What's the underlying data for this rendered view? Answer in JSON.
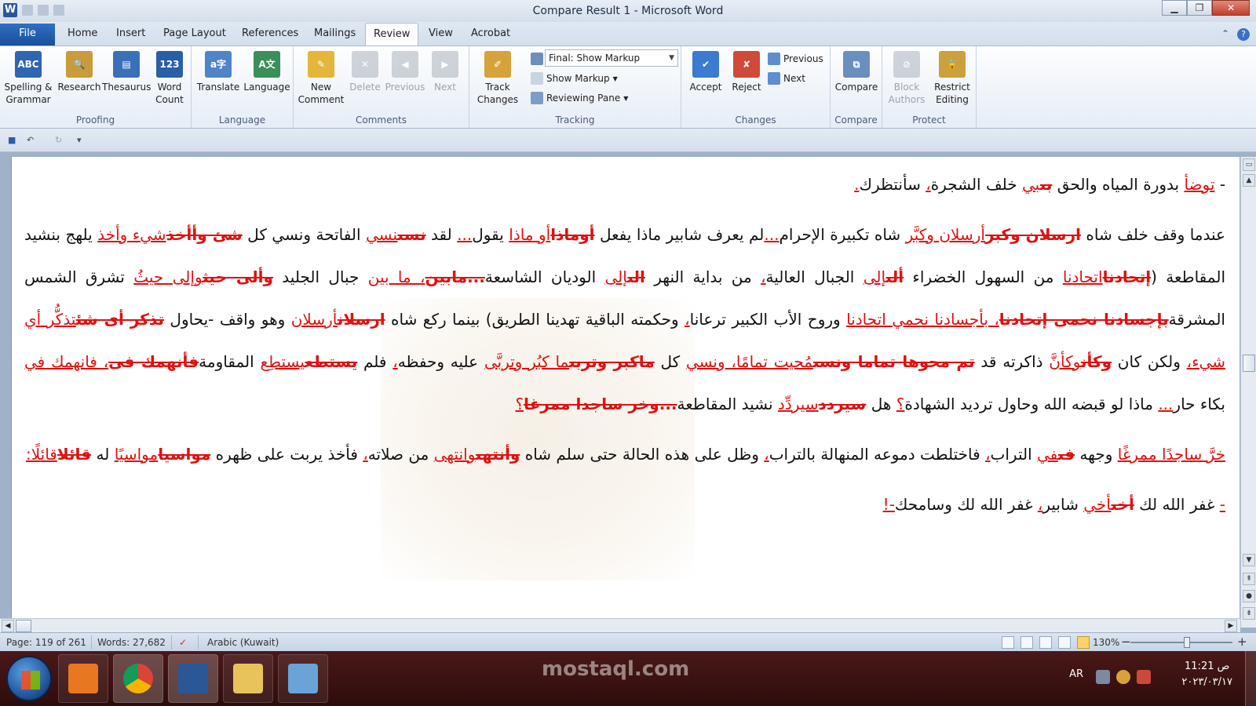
{
  "window": {
    "title": "Compare Result 1 - Microsoft Word",
    "minimize": "▁",
    "maximize": "❐",
    "close": "✕",
    "app_icon": "W"
  },
  "tabs": {
    "file": "File",
    "items": [
      "Home",
      "Insert",
      "Page Layout",
      "References",
      "Mailings",
      "Review",
      "View",
      "Acrobat"
    ],
    "active": "Review",
    "help": "?"
  },
  "ribbon": {
    "proofing": {
      "label": "Proofing",
      "spelling": "Spelling &\nGrammar",
      "research": "Research",
      "thesaurus": "Thesaurus",
      "word_count": "Word\nCount"
    },
    "language": {
      "label": "Language",
      "translate": "Translate",
      "language": "Language"
    },
    "comments": {
      "label": "Comments",
      "new_comment": "New\nComment",
      "delete": "Delete",
      "previous": "Previous",
      "next": "Next"
    },
    "tracking": {
      "label": "Tracking",
      "track_changes": "Track\nChanges",
      "display_select": "Final: Show Markup",
      "show_markup": "Show Markup",
      "reviewing_pane": "Reviewing Pane"
    },
    "changes": {
      "label": "Changes",
      "accept": "Accept",
      "reject": "Reject",
      "previous": "Previous",
      "next": "Next"
    },
    "compare": {
      "label": "Compare",
      "compare": "Compare"
    },
    "protect": {
      "label": "Protect",
      "block_authors": "Block\nAuthors",
      "restrict_editing": "Restrict\nEditing"
    }
  },
  "document": {
    "paragraphs": [
      [
        [
          "n",
          "- "
        ],
        [
          "i",
          "توضأ"
        ],
        [
          "n",
          " بدورة المياه والحق "
        ],
        [
          "d",
          "بى"
        ],
        [
          "i",
          "بي"
        ],
        [
          "n",
          " خلف الشجرة"
        ],
        [
          "i",
          "،"
        ],
        [
          "n",
          " سأنتظرك"
        ],
        [
          "i",
          "."
        ]
      ],
      [
        [
          "n",
          "عندما وقف خلف شاه "
        ],
        [
          "d",
          "ارسلان وكبر"
        ],
        [
          "i",
          "أرسلان وكبَّر"
        ],
        [
          "n",
          " شاه تكبيرة الإحرام"
        ],
        [
          "i",
          "..."
        ],
        [
          "n",
          "لم يعرف شابير ماذا يفعل "
        ],
        [
          "d",
          "أوماذا"
        ],
        [
          "i",
          "أو ماذا"
        ],
        [
          "n",
          " يقول"
        ],
        [
          "i",
          "..."
        ],
        [
          "n",
          " لقد "
        ],
        [
          "d",
          "نسى"
        ],
        [
          "i",
          "نسي"
        ],
        [
          "n",
          " الفاتحة ونسي كل "
        ],
        [
          "d",
          "شئ وأأخذ"
        ],
        [
          "i",
          "شيء وأخذ"
        ],
        [
          "n",
          " يلهج بنشيد المقاطعة ("
        ],
        [
          "d",
          "إتحادنا"
        ],
        [
          "i",
          "اتحادنا"
        ],
        [
          "n",
          " من السهول الخضراء "
        ],
        [
          "d",
          "ألى"
        ],
        [
          "i",
          "إلى"
        ],
        [
          "n",
          " الجبال العالية"
        ],
        [
          "i",
          "،"
        ],
        [
          "n",
          " من بداية النهر "
        ],
        [
          "d",
          "الى"
        ],
        [
          "i",
          "إلى"
        ],
        [
          "n",
          " الوديان الشاسعة"
        ],
        [
          "d",
          "...مابين"
        ],
        [
          "i",
          "، ما بين"
        ],
        [
          "n",
          " جبال الجليد "
        ],
        [
          "d",
          "وألى حيث"
        ],
        [
          "i",
          "وإلى حيثُ"
        ],
        [
          "n",
          " تشرق الشمس المشرقة"
        ],
        [
          "d",
          "بإجسادنا نحمى إتحادنا"
        ],
        [
          "i",
          "، بأجسادنا نحمي اتحادنا"
        ],
        [
          "n",
          " وروح الأب الكبير ترعانا"
        ],
        [
          "i",
          "،"
        ],
        [
          "n",
          " وحكمته الباقية تهدينا الطريق) بينما ركع شاه "
        ],
        [
          "d",
          "ارسلان"
        ],
        [
          "i",
          "أرسلان"
        ],
        [
          "n",
          " وهو واقف -يحاول "
        ],
        [
          "d",
          "تذكر أى شئ"
        ],
        [
          "i",
          "تذكُّر أي شيء"
        ],
        [
          "i",
          "،"
        ],
        [
          "n",
          " ولكن كان "
        ],
        [
          "d",
          "وكأن"
        ],
        [
          "i",
          "وكأنَّ"
        ],
        [
          "n",
          " ذاكرته قد "
        ],
        [
          "d",
          "تم محوها تماما ونسى"
        ],
        [
          "i",
          "مُحيت تمامًا، ونسي"
        ],
        [
          "n",
          " كل "
        ],
        [
          "d",
          "ماكبر وتربى"
        ],
        [
          "i",
          "ما كبُر وتربَّى"
        ],
        [
          "n",
          " عليه وحفظه"
        ],
        [
          "i",
          "،"
        ],
        [
          "n",
          " فلم "
        ],
        [
          "d",
          "يستطع"
        ],
        [
          "i",
          "يستطِع"
        ],
        [
          "n",
          " المقاومة"
        ],
        [
          "d",
          "فأنهمك فى"
        ],
        [
          "i",
          "، فانهمك في"
        ],
        [
          "n",
          " بكاء حار"
        ],
        [
          "i",
          "..."
        ],
        [
          "n",
          " ماذا لو قبضه الله وحاول ترديد الشهادة"
        ],
        [
          "i",
          "؟"
        ],
        [
          "n",
          " هل "
        ],
        [
          "d",
          "سيردد"
        ],
        [
          "i",
          "سيردِّد"
        ],
        [
          "n",
          " نشيد المقاطعة"
        ],
        [
          "d",
          "...وخر ساجدا ممرغا"
        ],
        [
          "i",
          "؟"
        ]
      ],
      [
        [
          "i",
          "خرَّ ساجدًا ممرغًا"
        ],
        [
          "n",
          " وجهه "
        ],
        [
          "d",
          "فى"
        ],
        [
          "i",
          "في"
        ],
        [
          "n",
          " التراب"
        ],
        [
          "i",
          "،"
        ],
        [
          "n",
          " فاختلطت دموعه المنهالة بالتراب"
        ],
        [
          "i",
          "،"
        ],
        [
          "n",
          " وظل على هذه الحالة حتى سلم شاه "
        ],
        [
          "d",
          "وأنتهى"
        ],
        [
          "i",
          "وانتهى"
        ],
        [
          "n",
          " من صلاته"
        ],
        [
          "i",
          "،"
        ],
        [
          "n",
          " فأخذ يربت على ظهره "
        ],
        [
          "d",
          "مواسيا"
        ],
        [
          "i",
          "مواسيًا"
        ],
        [
          "n",
          " له "
        ],
        [
          "d",
          "قائلا"
        ],
        [
          "i",
          "قائلًا:"
        ]
      ],
      [
        [
          "i",
          "-"
        ],
        [
          "n",
          " غفر الله لك "
        ],
        [
          "d",
          "أخى"
        ],
        [
          "i",
          "أخي"
        ],
        [
          "n",
          " شابير"
        ],
        [
          "i",
          "،"
        ],
        [
          "n",
          " غفر الله لك وسامحك"
        ],
        [
          "i",
          "-!"
        ]
      ]
    ]
  },
  "quick_access": {
    "save_icon": "■",
    "undo_icon": "↶",
    "redo_icon": "↻",
    "customize_icon": "▾"
  },
  "statusbar": {
    "page": "Page: 119 of 261",
    "words": "Words: 27,682",
    "language": "Arabic (Kuwait)",
    "zoom": "130%",
    "zoom_minus": "−",
    "zoom_plus": "+",
    "zoom_level": 0.55
  },
  "taskbar": {
    "lang": "AR",
    "time": "11:21 ص",
    "date": "٢٠٢٣/٠٣/١٧",
    "watermark": "mostaql.com"
  },
  "colors": {
    "revision": "#e01010",
    "file_tab": "#2f6fc4",
    "taskbar": "#3a1010"
  }
}
